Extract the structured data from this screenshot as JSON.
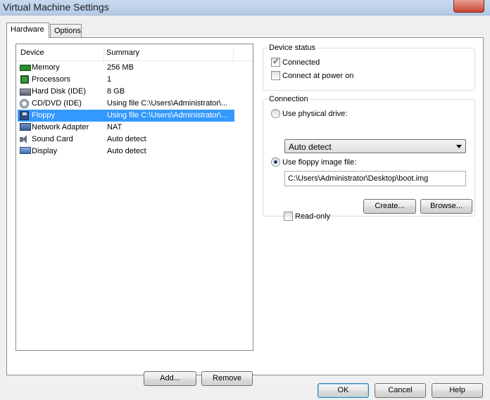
{
  "window": {
    "title": "Virtual Machine Settings"
  },
  "tabs": [
    {
      "label": "Hardware",
      "active": true
    },
    {
      "label": "Options",
      "active": false
    }
  ],
  "device_list": {
    "columns": [
      "Device",
      "Summary"
    ],
    "rows": [
      {
        "icon": "memory-icon",
        "device": "Memory",
        "summary": "256 MB"
      },
      {
        "icon": "processor-icon",
        "device": "Processors",
        "summary": "1"
      },
      {
        "icon": "hard-disk-icon",
        "device": "Hard Disk (IDE)",
        "summary": "8 GB"
      },
      {
        "icon": "cd-dvd-icon",
        "device": "CD/DVD (IDE)",
        "summary": "Using file C:\\Users\\Administrator\\..."
      },
      {
        "icon": "floppy-icon",
        "device": "Floppy",
        "summary": "Using file C:\\Users\\Administrator\\...",
        "selected": true
      },
      {
        "icon": "network-adapter-icon",
        "device": "Network Adapter",
        "summary": "NAT"
      },
      {
        "icon": "sound-card-icon",
        "device": "Sound Card",
        "summary": "Auto detect"
      },
      {
        "icon": "display-icon",
        "device": "Display",
        "summary": "Auto detect"
      }
    ],
    "add_label": "Add...",
    "remove_label": "Remove"
  },
  "device_status": {
    "legend": "Device status",
    "connected": {
      "label": "Connected",
      "checked": true
    },
    "connect_at_power_on": {
      "label": "Connect at power on",
      "checked": false
    }
  },
  "connection": {
    "legend": "Connection",
    "physical_drive": {
      "label": "Use physical drive:",
      "selected": false
    },
    "drive_select_value": "Auto detect",
    "image_file": {
      "label": "Use floppy image file:",
      "selected": true
    },
    "image_path": "C:\\Users\\Administrator\\Desktop\\boot.img",
    "create_label": "Create...",
    "browse_label": "Browse...",
    "read_only": {
      "label": "Read-only",
      "checked": false
    }
  },
  "footer": {
    "ok_label": "OK",
    "cancel_label": "Cancel",
    "help_label": "Help"
  }
}
